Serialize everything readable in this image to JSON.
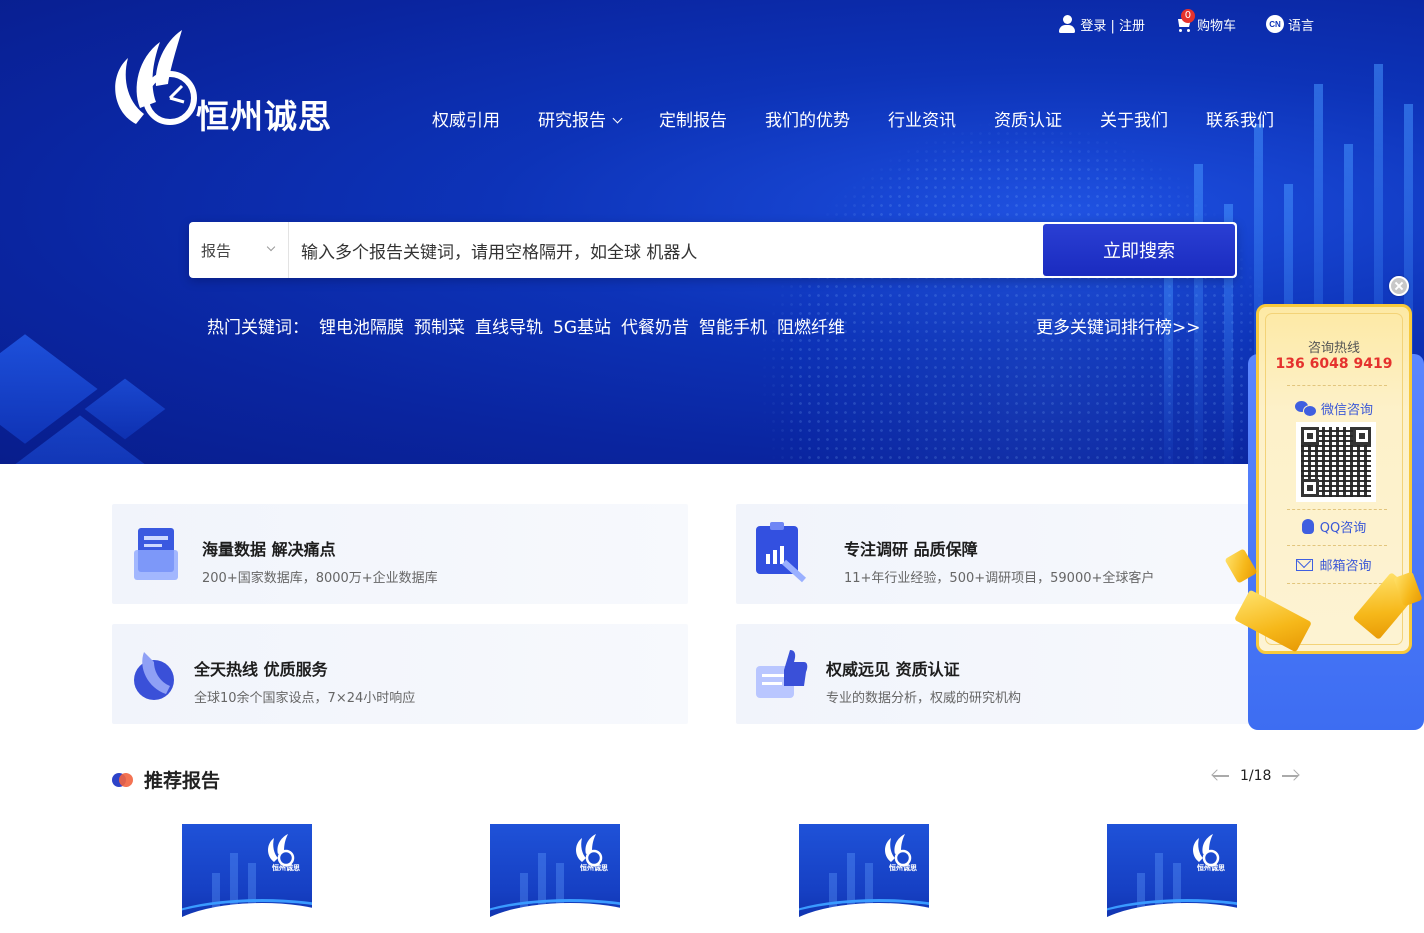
{
  "topbar": {
    "login": "登录 | 注册",
    "cart_count": "0",
    "cart": "购物车",
    "lang_badge": "CN",
    "language": "语言"
  },
  "logo": {
    "text": "恒州诚思"
  },
  "nav": [
    {
      "label": "权威引用"
    },
    {
      "label": "研究报告"
    },
    {
      "label": "定制报告"
    },
    {
      "label": "我们的优势"
    },
    {
      "label": "行业资讯"
    },
    {
      "label": "资质认证"
    },
    {
      "label": "关于我们"
    },
    {
      "label": "联系我们"
    }
  ],
  "search": {
    "category": "报告",
    "placeholder": "输入多个报告关键词，请用空格隔开，如全球 机器人",
    "button": "立即搜索"
  },
  "hot": {
    "label": "热门关键词：",
    "keywords": [
      "锂电池隔膜",
      "预制菜",
      "直线导轨",
      "5G基站",
      "代餐奶昔",
      "智能手机",
      "阻燃纤维"
    ],
    "more": "更多关键词排行榜>>"
  },
  "features": [
    {
      "title": "海量数据 解决痛点",
      "desc": "200+国家数据库，8000万+企业数据库"
    },
    {
      "title": "专注调研 品质保障",
      "desc": "11+年行业经验，500+调研项目，59000+全球客户"
    },
    {
      "title": "全天热线 优质服务",
      "desc": "全球10余个国家设点，7×24小时响应"
    },
    {
      "title": "权威远见 资质认证",
      "desc": "专业的数据分析，权威的研究机构"
    }
  ],
  "recommend": {
    "title": "推荐报告",
    "page": "1/18",
    "card_brand": "恒州诚思"
  },
  "consult": {
    "hotline_label": "咨询热线",
    "phone": "136 6048 9419",
    "wechat": "微信咨询",
    "qq": "QQ咨询",
    "email": "邮箱咨询"
  },
  "colors": {
    "hero_blue": "#0d33b8",
    "button_blue": "#2a3fd4",
    "phone_red": "#e5322d",
    "gold": "#f8c93c"
  }
}
